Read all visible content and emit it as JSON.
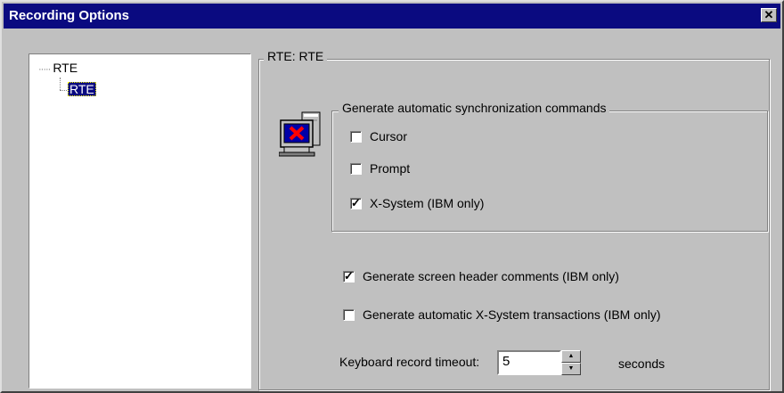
{
  "window": {
    "title": "Recording Options",
    "close_glyph": "✕"
  },
  "tree": {
    "root": "RTE",
    "child": "RTE"
  },
  "main_group": {
    "legend": "RTE: RTE"
  },
  "sync_group": {
    "legend": "Generate automatic synchronization commands",
    "icon": "monitor-x-icon",
    "options": [
      {
        "label": "Cursor",
        "checked": false
      },
      {
        "label": "Prompt",
        "checked": false
      },
      {
        "label": "X-System (IBM only)",
        "checked": true
      }
    ]
  },
  "options": [
    {
      "label": "Generate screen header comments (IBM only)",
      "checked": true
    },
    {
      "label": "Generate automatic X-System transactions (IBM only)",
      "checked": false
    }
  ],
  "timeout": {
    "label": "Keyboard record timeout:",
    "value": "5",
    "unit": "seconds"
  },
  "colors": {
    "titlebar": "#0a0a80",
    "face": "#c0c0c0",
    "selection": "#0a0a80"
  }
}
